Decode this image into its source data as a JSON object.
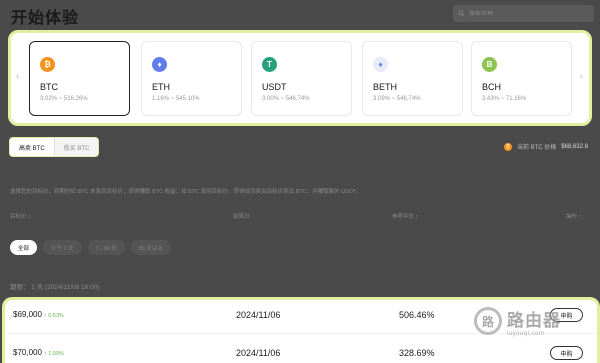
{
  "header": {
    "title": "开始体验",
    "search_placeholder": "搜索币种"
  },
  "coins": [
    {
      "name": "BTC",
      "range": "3.02% ~ 516.26%",
      "icon": "bitcoin-icon",
      "color": "#f7931a",
      "glyph": "₿"
    },
    {
      "name": "ETH",
      "range": "1.16% ~ 545.10%",
      "icon": "ethereum-icon",
      "color": "#627eea",
      "glyph": "♦"
    },
    {
      "name": "USDT",
      "range": "3.00% ~ 546.74%",
      "icon": "tether-icon",
      "color": "#26a17b",
      "glyph": "T"
    },
    {
      "name": "BETH",
      "range": "3.09% ~ 546.74%",
      "icon": "beth-icon",
      "color": "#e8ecf8",
      "glyph": "♦"
    },
    {
      "name": "BCH",
      "range": "3.43% ~ 71.16%",
      "icon": "bitcoin-cash-icon",
      "color": "#8dc351",
      "glyph": "B"
    }
  ],
  "mode_tabs": {
    "sell_high": "高卖 BTC",
    "buy_low": "低买 BTC"
  },
  "price_ref": {
    "label": "当前 BTC 价格",
    "value": "$68,632.8"
  },
  "description": "选择您的目标价，到期时如 BTC 未涨到目标价，获得赚取 BTC 收益；如 BTC 涨到目标价，获得成功卖出目标价卖出 BTC，并赚取额外 USDT。",
  "columns": {
    "target": "目标价 ↕",
    "settle": "结算日",
    "apy": "参考年化 ↕",
    "action": "操作 ↕"
  },
  "filters": [
    "全部",
    "少于 7 天",
    "7 - 30 天",
    "30 天以上"
  ],
  "settle_label": "期限： 1 天 (2024/11/06 16:00)",
  "rows": [
    {
      "price": "$69,000",
      "pct": "↑ 0.53%",
      "date": "2024/11/06",
      "yield": "506.46%",
      "action": "申购"
    },
    {
      "price": "$70,000",
      "pct": "↑ 1.99%",
      "date": "2024/11/06",
      "yield": "328.69%",
      "action": "申购"
    }
  ],
  "watermark": {
    "logo": "路",
    "name": "路由器",
    "url": "luyouqi.com"
  }
}
